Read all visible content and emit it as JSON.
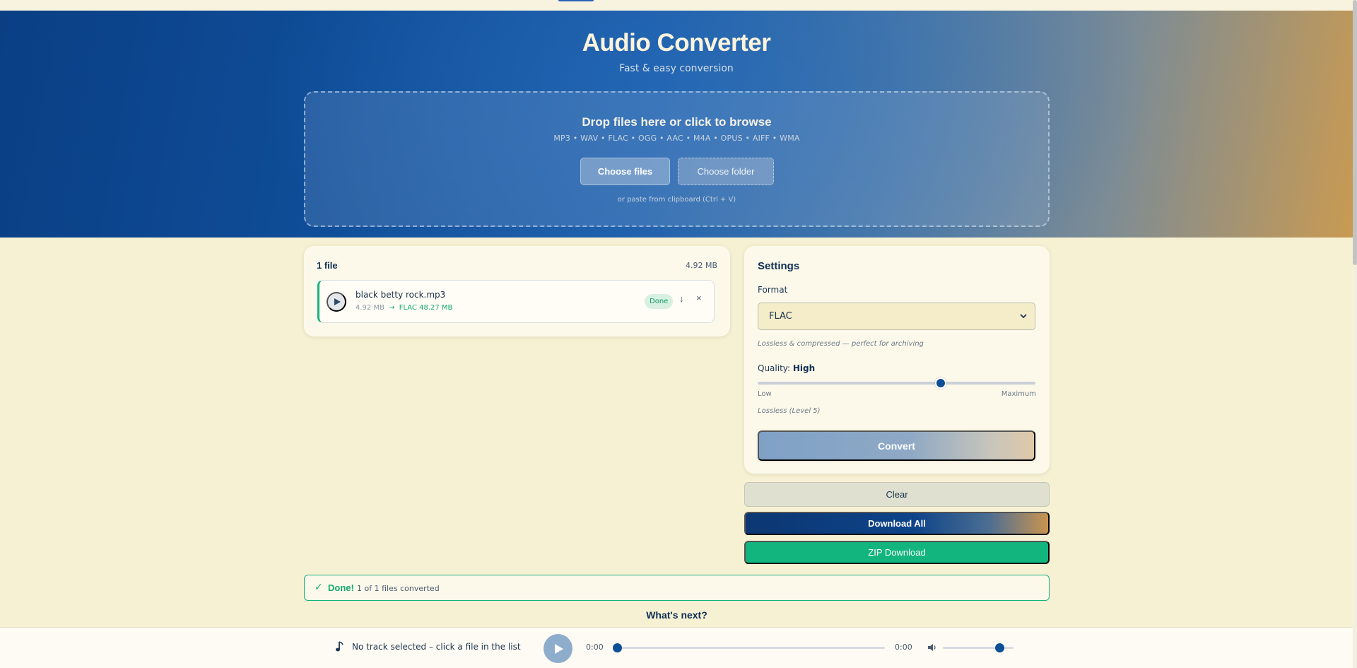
{
  "header": {
    "title": "Audio Converter",
    "subtitle": "Fast & easy conversion"
  },
  "dropzone": {
    "title": "Drop files here or click to browse",
    "formats": "MP3 • WAV • FLAC • OGG • AAC • M4A • OPUS • AIFF • WMA",
    "choose_files": "Choose files",
    "choose_folder": "Choose folder",
    "paste_hint": "or paste from clipboard (Ctrl + V)"
  },
  "file_list": {
    "count": "1 file",
    "total_size": "4.92 MB",
    "files": [
      {
        "name": "black betty rock.mp3",
        "original_size": "4.92 MB",
        "arrow": "→",
        "output": "FLAC 48.27 MB",
        "status": "Done",
        "download_icon": "↓",
        "remove_icon": "×"
      }
    ]
  },
  "settings": {
    "title": "Settings",
    "format_label": "Format",
    "format_value": "FLAC",
    "format_description": "Lossless & compressed — perfect for archiving",
    "quality_label": "Quality:",
    "quality_value": "High",
    "quality_level": 0.66,
    "slider_low": "Low",
    "slider_high": "Maximum",
    "level_note": "Lossless (Level 5)",
    "convert": "Convert"
  },
  "actions": {
    "clear": "Clear",
    "download_all": "Download All",
    "zip_download": "ZIP Download"
  },
  "status": {
    "check": "✓",
    "word": "Done!",
    "text": "1 of 1 files converted"
  },
  "whats_next": "What's next?",
  "player": {
    "track": "No track selected – click a file in the list",
    "current_time": "0:00",
    "duration": "0:00",
    "seek_progress": 0,
    "volume": 0.8
  },
  "colors": {
    "accent": "#0d4f96",
    "success": "#14b37c",
    "background": "#f7f1d4"
  }
}
